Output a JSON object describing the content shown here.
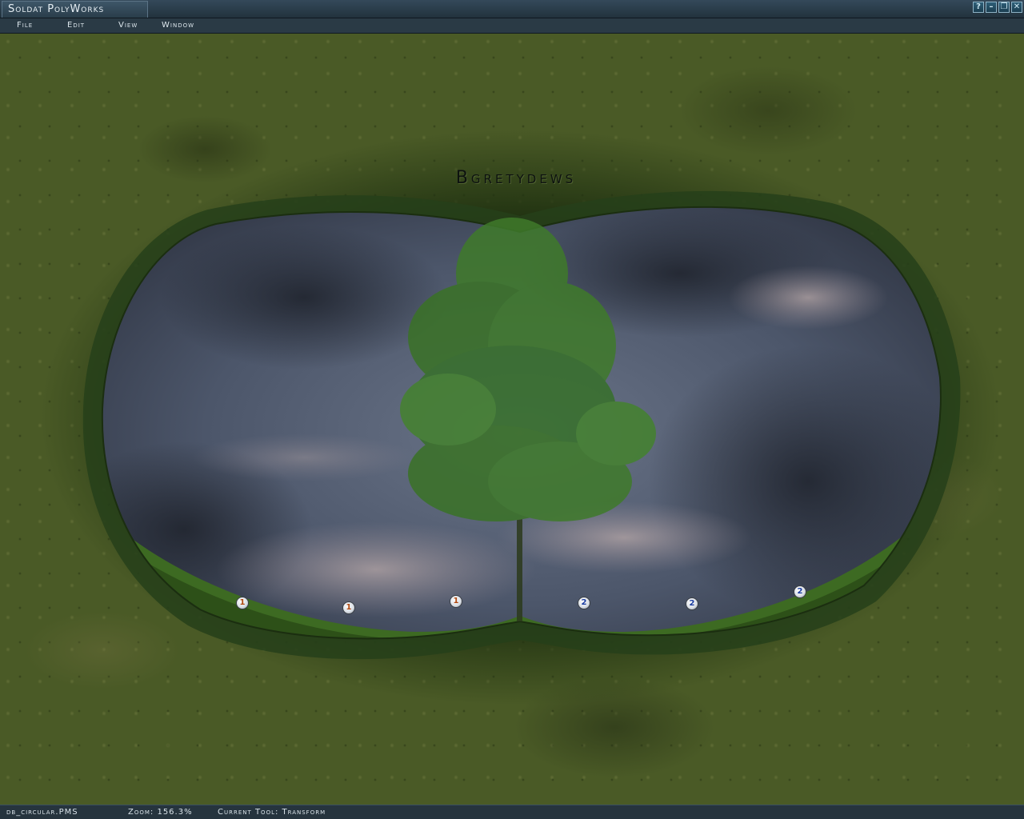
{
  "window": {
    "title": "Soldat PolyWorks",
    "controls": {
      "help": "?",
      "minimize": "–",
      "restore": "❐",
      "close": "✕"
    }
  },
  "menu": [
    "File",
    "Edit",
    "View",
    "Window"
  ],
  "canvas": {
    "map_label": "Bgretydews",
    "spawn_points": [
      {
        "team": "1"
      },
      {
        "team": "1"
      },
      {
        "team": "1"
      },
      {
        "team": "2"
      },
      {
        "team": "2"
      },
      {
        "team": "2"
      }
    ],
    "colors": {
      "grass": "#4a5a26",
      "sky": "#4a5468",
      "tree": "#3f7a2a"
    }
  },
  "status": {
    "file": "db_circular.PMS",
    "zoom": "Zoom: 156.3%",
    "tool": "Current Tool: Transform"
  }
}
